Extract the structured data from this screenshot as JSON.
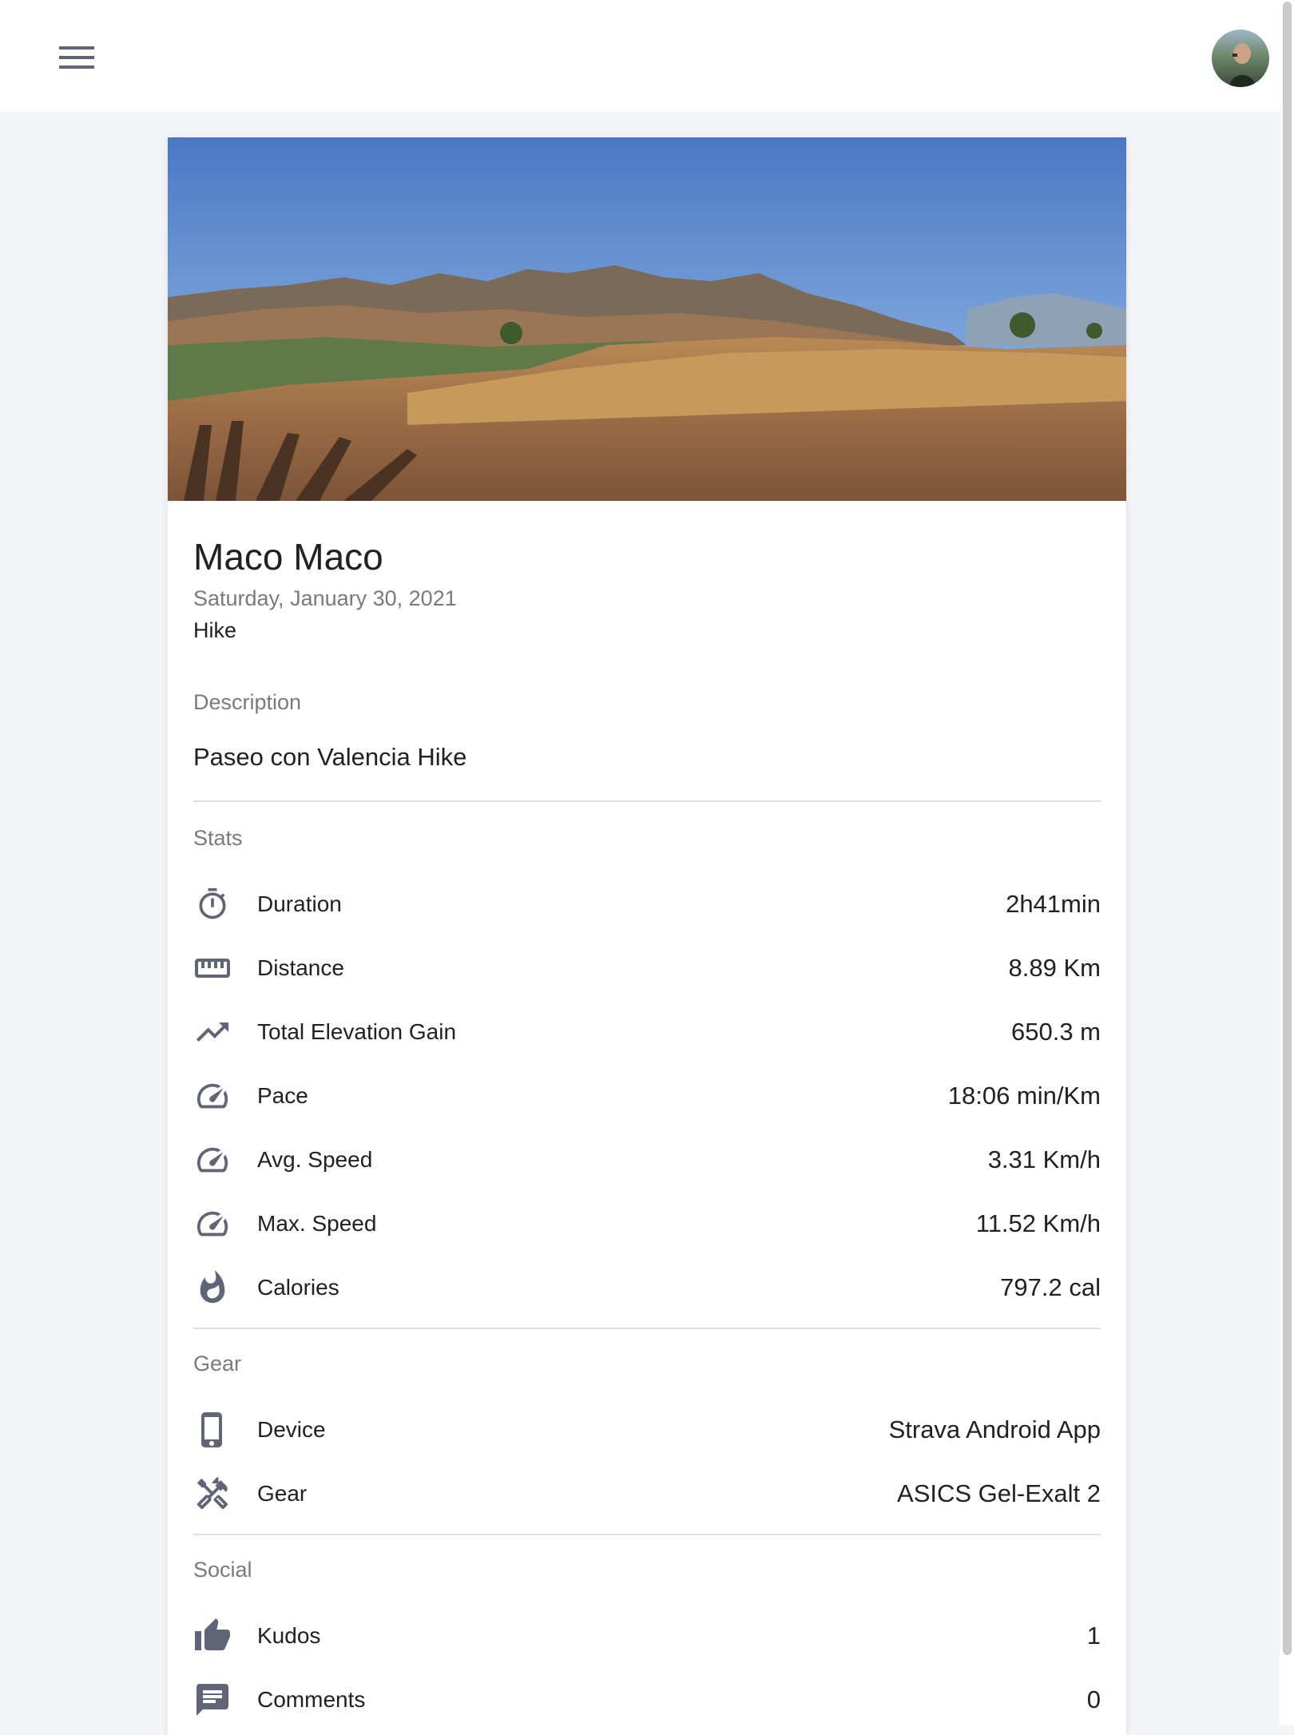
{
  "header": {
    "menu_icon": "hamburger-menu-icon",
    "avatar_icon": "user-avatar"
  },
  "activity": {
    "title": "Maco Maco",
    "date": "Saturday, January 30, 2021",
    "type": "Hike"
  },
  "description": {
    "label": "Description",
    "text": "Paseo con Valencia Hike"
  },
  "stats": {
    "label": "Stats",
    "items": [
      {
        "icon": "timer-icon",
        "label": "Duration",
        "value": "2h41min"
      },
      {
        "icon": "ruler-icon",
        "label": "Distance",
        "value": "8.89 Km"
      },
      {
        "icon": "trending-up-icon",
        "label": "Total Elevation Gain",
        "value": "650.3 m"
      },
      {
        "icon": "speedometer-icon",
        "label": "Pace",
        "value": "18:06 min/Km"
      },
      {
        "icon": "speedometer-icon",
        "label": "Avg. Speed",
        "value": "3.31 Km/h"
      },
      {
        "icon": "speedometer-icon",
        "label": "Max. Speed",
        "value": "11.52 Km/h"
      },
      {
        "icon": "flame-icon",
        "label": "Calories",
        "value": "797.2 cal"
      }
    ]
  },
  "gear": {
    "label": "Gear",
    "items": [
      {
        "icon": "phone-icon",
        "label": "Device",
        "value": "Strava Android App"
      },
      {
        "icon": "tools-icon",
        "label": "Gear",
        "value": "ASICS Gel-Exalt 2"
      }
    ]
  },
  "social": {
    "label": "Social",
    "items": [
      {
        "icon": "thumbs-up-icon",
        "label": "Kudos",
        "value": "1"
      },
      {
        "icon": "comment-icon",
        "label": "Comments",
        "value": "0"
      }
    ]
  },
  "colors": {
    "icon": "#5f6577",
    "background": "#f3f4f8",
    "divider": "#dedede",
    "muted_text": "#7a7a7a"
  }
}
